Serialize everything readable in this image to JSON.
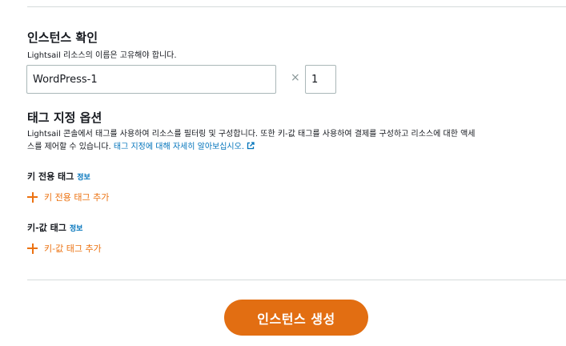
{
  "instance_confirm": {
    "title": "인스턴스 확인",
    "description": "Lightsail 리소스의 이름은 고유해야 합니다.",
    "name_value": "WordPress-1",
    "times_symbol": "×",
    "count_value": "1"
  },
  "tag_options": {
    "title": "태그 지정 옵션",
    "description": "Lightsail 콘솔에서 태그를 사용하여 리소스를 필터링 및 구성합니다. 또한 키-값 태그를 사용하여 결제를 구성하고 리소스에 대한 액세스를 제어할 수 있습니다. ",
    "learn_more_link": "태그 지정에 대해 자세히 알아보십시오."
  },
  "key_only_tags": {
    "title": "키 전용 태그",
    "info": "정보",
    "add_label": "키 전용 태그 추가"
  },
  "key_value_tags": {
    "title": "키-값 태그",
    "info": "정보",
    "add_label": "키-값 태그 추가"
  },
  "create_button": "인스턴스 생성",
  "colors": {
    "accent_orange": "#ec7211",
    "button_orange": "#e26e12",
    "link_blue": "#0073bb"
  }
}
